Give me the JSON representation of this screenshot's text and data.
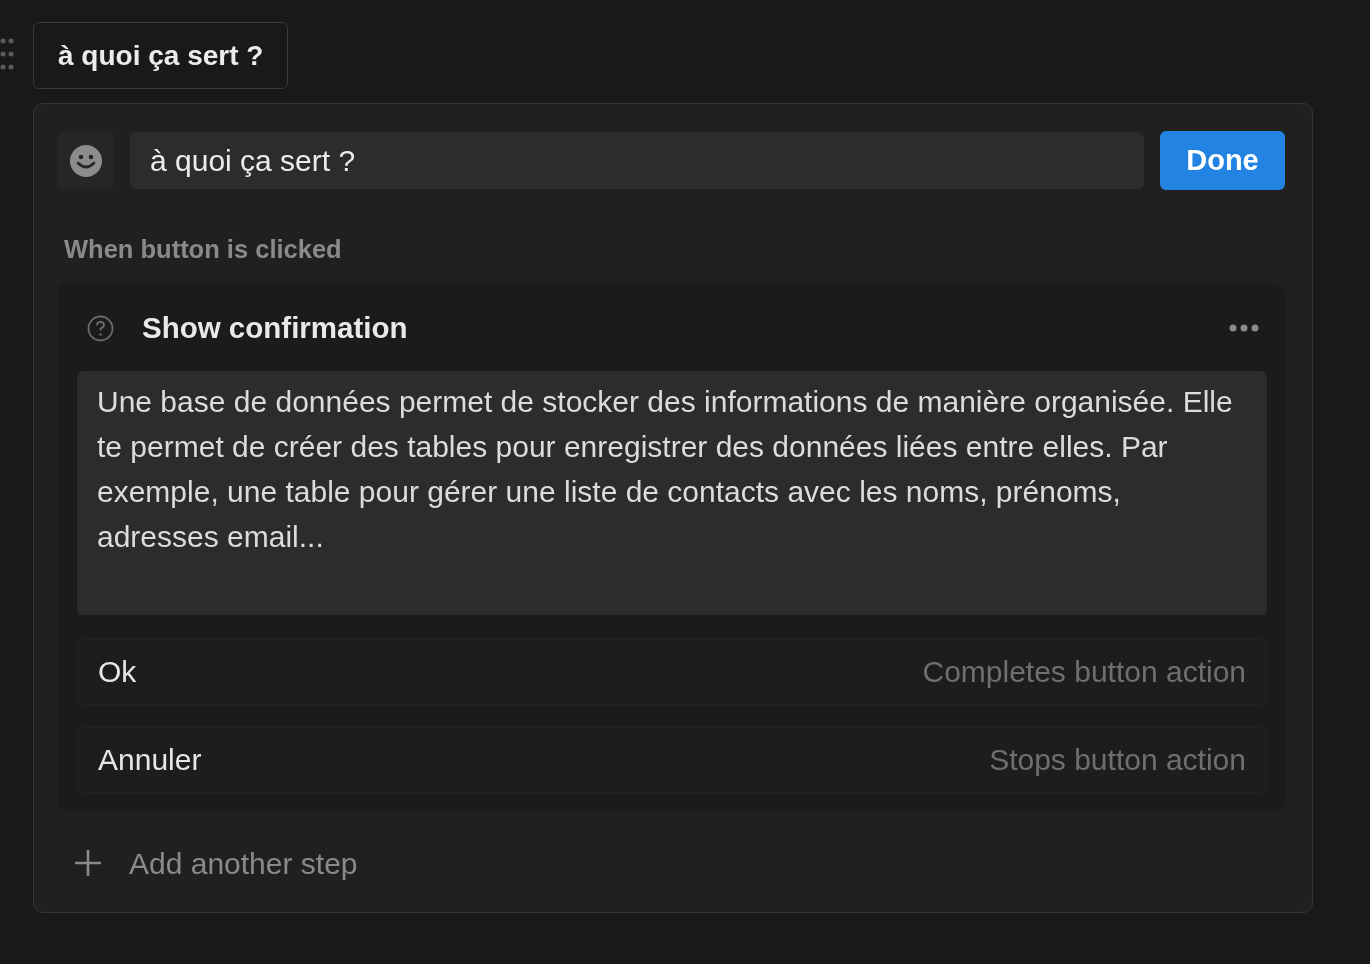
{
  "block_button": {
    "label": "à quoi ça sert ?"
  },
  "editor": {
    "name_value": "à quoi ça sert ?",
    "done_label": "Done",
    "section_label": "When button is clicked",
    "step": {
      "title": "Show confirmation",
      "message": "Une base de données permet de stocker des informations de manière organisée. Elle te permet de créer des tables pour enregistrer des données liées entre elles. Par exemple, une table pour gérer une liste de contacts avec les noms, prénoms, adresses email...",
      "options": [
        {
          "label": "Ok",
          "hint": "Completes button action"
        },
        {
          "label": "Annuler",
          "hint": "Stops button action"
        }
      ]
    },
    "add_step": "Add another step"
  }
}
